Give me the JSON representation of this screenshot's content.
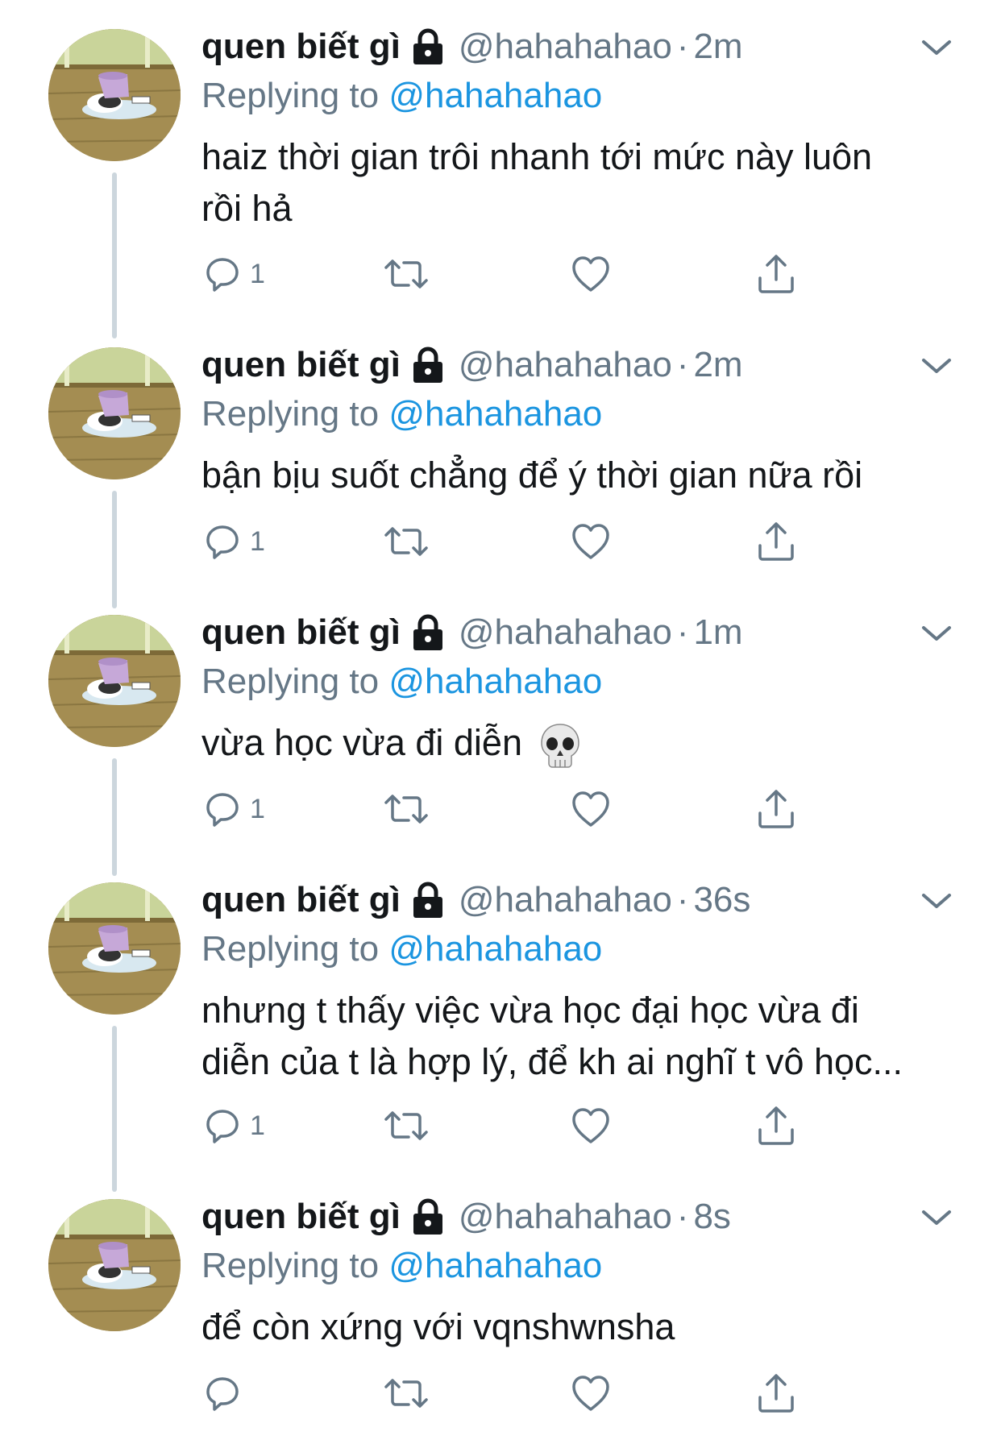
{
  "colors": {
    "text": "#14171a",
    "secondary": "#657786",
    "link": "#1b95e0",
    "connector": "#ccd6dd"
  },
  "tweets": [
    {
      "name": "quen biết gì",
      "handle": "@hahahahao",
      "separator": "·",
      "time": "2m",
      "replying_prefix": "Replying to",
      "replying_handle": "@hahahahao",
      "text_lines": [
        "haiz thời gian trôi nhanh tới mức này luôn",
        "rồi hả"
      ],
      "reply_count": "1"
    },
    {
      "name": "quen biết gì",
      "handle": "@hahahahao",
      "separator": "·",
      "time": "2m",
      "replying_prefix": "Replying to",
      "replying_handle": "@hahahahao",
      "text_lines": [
        "bận bịu suốt chẳng để ý thời gian nữa rồi"
      ],
      "reply_count": "1"
    },
    {
      "name": "quen biết gì",
      "handle": "@hahahahao",
      "separator": "·",
      "time": "1m",
      "replying_prefix": "Replying to",
      "replying_handle": "@hahahahao",
      "text_lines": [
        "vừa học vừa đi diễn"
      ],
      "emoji": "skull-icon",
      "reply_count": "1"
    },
    {
      "name": "quen biết gì",
      "handle": "@hahahahao",
      "separator": "·",
      "time": "36s",
      "replying_prefix": "Replying to",
      "replying_handle": "@hahahahao",
      "text_lines": [
        "nhưng t thấy việc vừa học đại học vừa đi",
        "diễn của t là hợp lý, để kh ai nghĩ t vô học..."
      ],
      "reply_count": "1"
    },
    {
      "name": "quen biết gì",
      "handle": "@hahahahao",
      "separator": "·",
      "time": "8s",
      "replying_prefix": "Replying to",
      "replying_handle": "@hahahahao",
      "text_lines": [
        "để còn xứng với vqnshwnsha"
      ],
      "reply_count": ""
    }
  ],
  "icons": {
    "lock": "lock-icon",
    "menu": "chevron-down-icon",
    "reply": "reply-icon",
    "retweet": "retweet-icon",
    "like": "heart-icon",
    "share": "share-icon"
  }
}
